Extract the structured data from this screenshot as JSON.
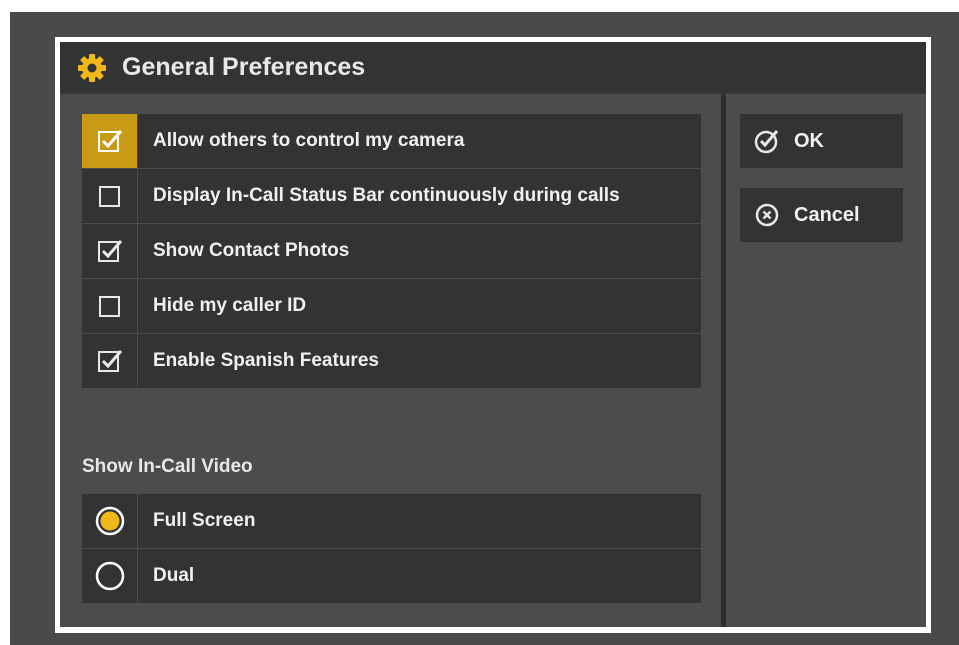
{
  "dialog": {
    "title": "General Preferences",
    "title_icon": "gear-icon",
    "accent_color": "#f0b818"
  },
  "options": [
    {
      "label": "Allow others to control my camera",
      "checked": true,
      "highlighted": true
    },
    {
      "label": "Display In-Call Status Bar continuously during calls",
      "checked": false,
      "highlighted": false
    },
    {
      "label": "Show Contact Photos",
      "checked": true,
      "highlighted": false
    },
    {
      "label": "Hide my caller ID",
      "checked": false,
      "highlighted": false
    },
    {
      "label": "Enable Spanish Features",
      "checked": true,
      "highlighted": false
    }
  ],
  "video": {
    "section_label": "Show In-Call Video",
    "choices": [
      {
        "label": "Full Screen",
        "selected": true
      },
      {
        "label": "Dual",
        "selected": false
      }
    ]
  },
  "actions": {
    "ok_label": "OK",
    "cancel_label": "Cancel"
  }
}
